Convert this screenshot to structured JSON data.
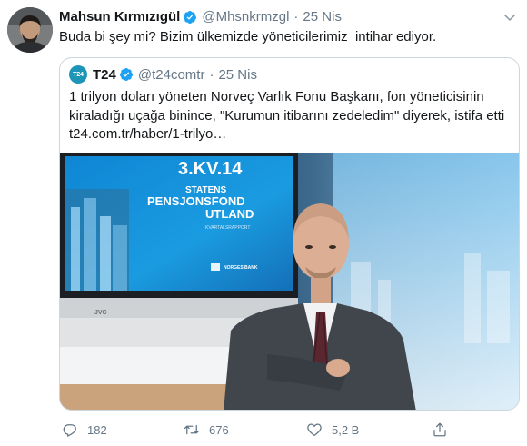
{
  "tweet": {
    "author_name": "Mahsun Kırmızıgül",
    "author_handle": "@Mhsnkrmzgl",
    "date": "25 Nis",
    "separator": "·",
    "text": "Buda bi şey mi? Bizim ülkemizde yöneticilerimiz  intihar ediyor."
  },
  "quoted": {
    "avatar_text": "T24",
    "author_name": "T24",
    "author_handle": "@t24comtr",
    "date": "25 Nis",
    "text": "1 trilyon doları yöneten Norveç Varlık Fonu Başkanı, fon yöneticisinin kiraladığı uçağa binince, \"Kurumun itibarını zedeledim\" diyerek, istifa etti t24.com.tr/haber/1-trilyo…",
    "image": {
      "screen_line1": "3.KV.14",
      "screen_line2": "STATENS",
      "screen_line3": "PENSJONSFOND",
      "screen_line4": "UTLAND",
      "screen_line5": "KVARTALSRAPPORT",
      "screen_logo": "NORGES BANK",
      "monitor_brand": "JVC"
    }
  },
  "actions": {
    "reply_count": "182",
    "retweet_count": "676",
    "like_count": "5,2 B"
  },
  "colors": {
    "verified": "#1da1f2",
    "secondary_text": "#657786",
    "border": "#ccd6dd"
  },
  "icons": [
    "verified-badge-icon",
    "caret-down-icon",
    "reply-icon",
    "retweet-icon",
    "like-icon",
    "share-icon"
  ]
}
